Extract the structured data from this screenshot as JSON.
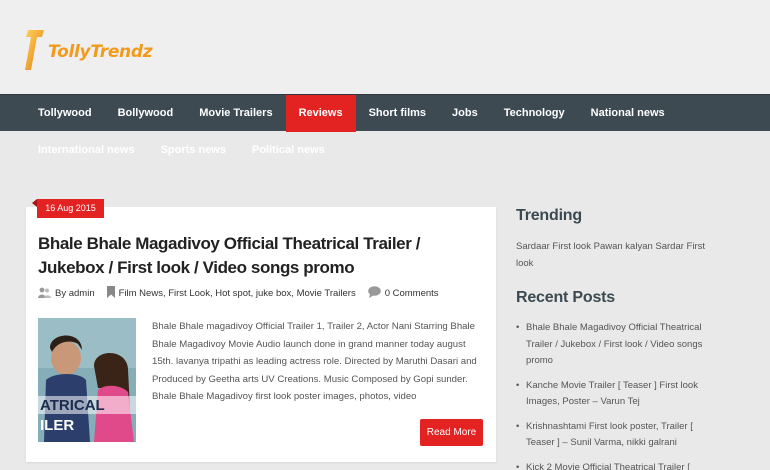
{
  "logo": {
    "text": "TollyTrendz"
  },
  "nav": {
    "items": [
      {
        "label": "Tollywood"
      },
      {
        "label": "Bollywood"
      },
      {
        "label": "Movie Trailers"
      },
      {
        "label": "Reviews"
      },
      {
        "label": "Short films"
      },
      {
        "label": "Jobs"
      },
      {
        "label": "Technology"
      },
      {
        "label": "National news"
      }
    ],
    "active_label": "Reviews",
    "sub_items": [
      {
        "label": "International news"
      },
      {
        "label": "Sports news"
      },
      {
        "label": "Political news"
      }
    ]
  },
  "post": {
    "date": "16 Aug 2015",
    "title": "Bhale Bhale Magadivoy Official Theatrical Trailer / Jukebox / First look / Video songs promo",
    "author_prefix": "By",
    "author": "admin",
    "categories": [
      "Film News",
      "First Look",
      "Hot spot",
      "juke box",
      "Movie Trailers"
    ],
    "comments": "0 Comments",
    "excerpt": "Bhale Bhale magadivoy Official Trailer 1, Trailer 2, Actor Nani Starring Bhale Bhale Magadivoy Movie Audio launch done in grand manner today august 15th. lavanya tripathi as leading actress role. Directed by Maruthi Dasari and Produced by Geetha arts UV Creations. Music Composed by Gopi sunder. Bhale Bhale Magadivoy first look poster images, photos, video",
    "thumb_text_1": "ATRICAL",
    "thumb_text_2": "ILER",
    "read_more": "Read More"
  },
  "sidebar": {
    "trending_heading": "Trending",
    "trending_text": "Sardaar First look Pawan kalyan Sardar First look",
    "recent_heading": "Recent Posts",
    "recent_posts": [
      {
        "label": "Bhale Bhale Magadivoy Official Theatrical Trailer / Jukebox / First look / Video songs promo"
      },
      {
        "label": "Kanche Movie Trailer [ Teaser ] First look Images, Poster – Varun Tej"
      },
      {
        "label": "Krishnashtami First look poster, Trailer [ Teaser ] – Sunil Varma, nikki galrani"
      },
      {
        "label": "Kick 2 Movie Official Theatrical Trailer ["
      }
    ]
  },
  "colors": {
    "accent": "#e32222",
    "nav_bg": "#3d4a52",
    "logo": "#f29a1c",
    "page_bg": "#e9e9e9"
  }
}
